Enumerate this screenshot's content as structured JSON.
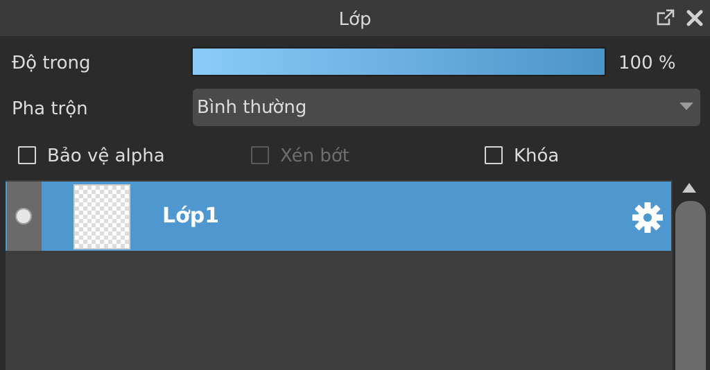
{
  "panel": {
    "title": "Lớp",
    "undock_icon": "undock-icon",
    "close_icon": "close-icon"
  },
  "opacity": {
    "label": "Độ trong",
    "value": "100 %",
    "fraction": 1.0,
    "gradient_from": "#8acbf8",
    "gradient_to": "#4c95c8"
  },
  "blend": {
    "label": "Pha trộn",
    "value": "Bình thường"
  },
  "options": {
    "protect_alpha": {
      "label": "Bảo vệ alpha",
      "checked": false,
      "enabled": true
    },
    "clip": {
      "label": "Xén bớt",
      "checked": false,
      "enabled": false
    },
    "lock": {
      "label": "Khóa",
      "checked": false,
      "enabled": true
    }
  },
  "layers": [
    {
      "name": "Lớp1",
      "visible": true,
      "selected": true,
      "settings_icon": "gear-icon"
    }
  ],
  "colors": {
    "accent": "#4f97cf",
    "background": "#2b2b2b",
    "titlebar": "#3a3a3a",
    "list": "#3d3d3d"
  }
}
